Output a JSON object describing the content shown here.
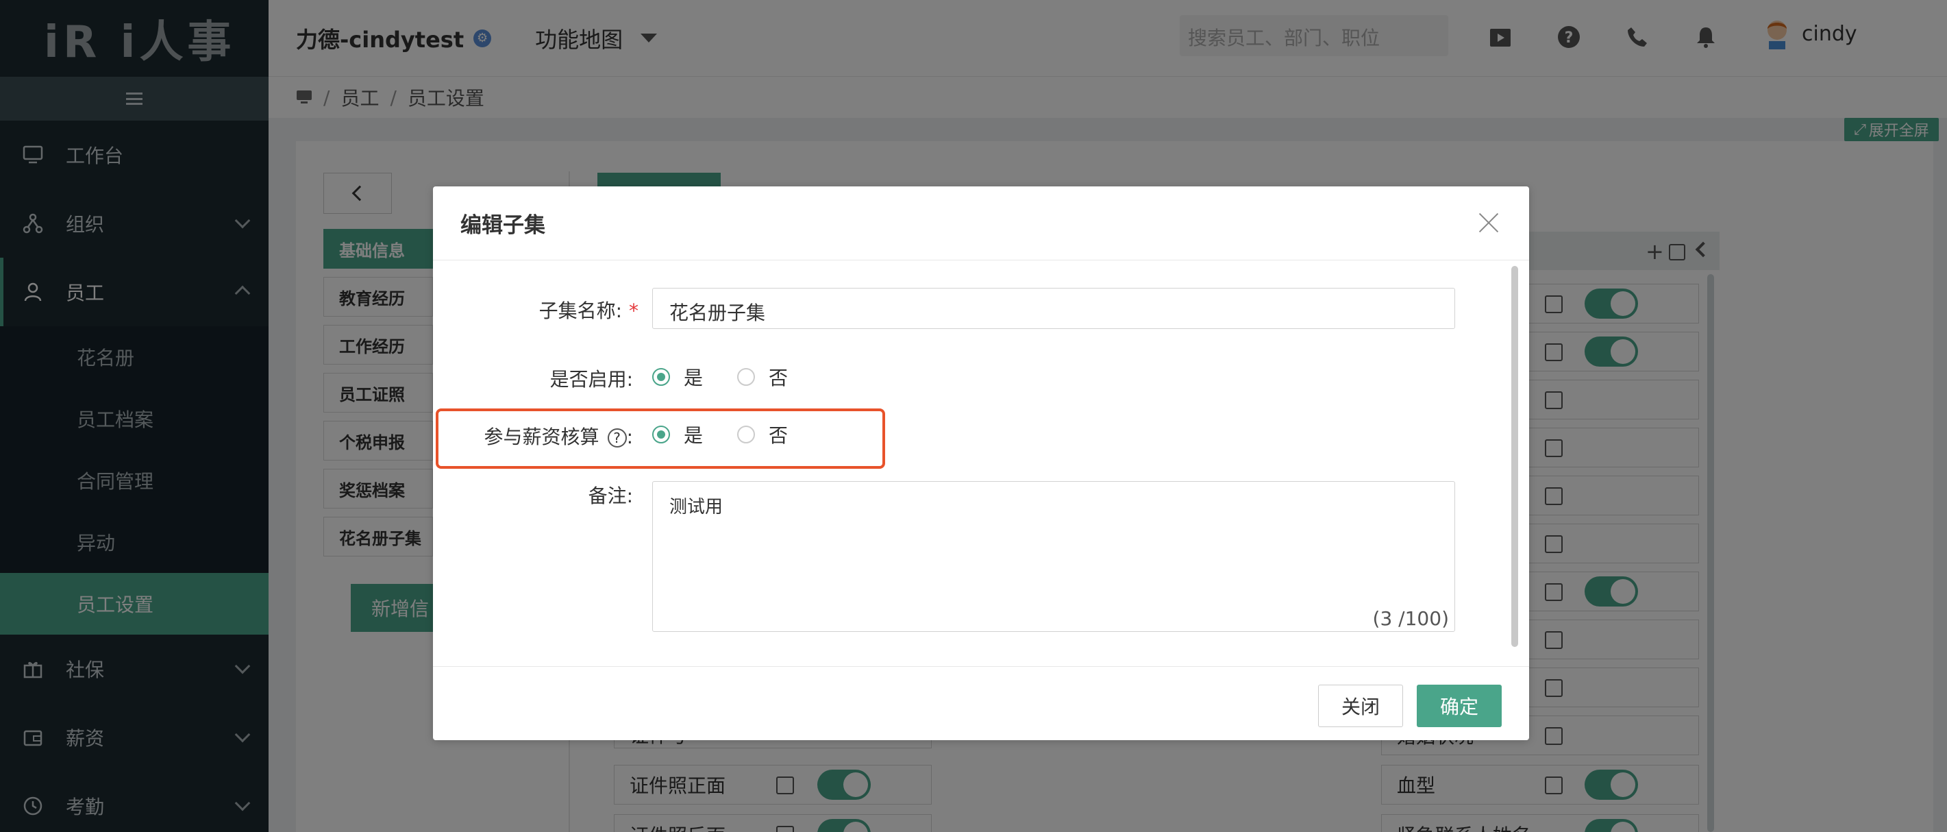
{
  "app": {
    "logo": "iR i人事"
  },
  "header": {
    "company": "力德-cindytest",
    "func_map": "功能地图",
    "search_placeholder": "搜索员工、部门、职位",
    "user_name": "cindy"
  },
  "sidebar": {
    "items": [
      {
        "label": "工作台",
        "icon": "monitor-icon"
      },
      {
        "label": "组织",
        "icon": "org-icon"
      },
      {
        "label": "员工",
        "icon": "user-icon"
      },
      {
        "label": "社保",
        "icon": "gift-icon"
      },
      {
        "label": "薪资",
        "icon": "wallet-icon"
      },
      {
        "label": "考勤",
        "icon": "clock-icon"
      }
    ],
    "sub_items": [
      "花名册",
      "员工档案",
      "合同管理",
      "异动",
      "员工设置"
    ]
  },
  "breadcrumb": {
    "items": [
      "员工",
      "员工设置"
    ]
  },
  "page": {
    "expand": "展开全屏",
    "subsets": [
      "基础信息",
      "教育经历",
      "工作经历",
      "员工证照",
      "个税申报",
      "奖惩档案",
      "花名册子集"
    ],
    "add_button": "新增信",
    "mid_fields": [
      "证件号",
      "证件照正面",
      "证件照反面"
    ],
    "right_fields": [
      "婚姻状况",
      "血型",
      "紧急联系人姓名"
    ]
  },
  "modal": {
    "title": "编辑子集",
    "name_label": "子集名称:",
    "name_value": "花名册子集",
    "enabled_label": "是否启用:",
    "payroll_label": "参与薪资核算",
    "yes": "是",
    "no": "否",
    "remark_label": "备注:",
    "remark_value": "测试用",
    "counter": "(3 /100)",
    "close_btn": "关闭",
    "ok_btn": "确定"
  },
  "colors": {
    "accent": "#4aa58a",
    "highlight": "#e8532b",
    "sidebar": "#1d2b31"
  }
}
